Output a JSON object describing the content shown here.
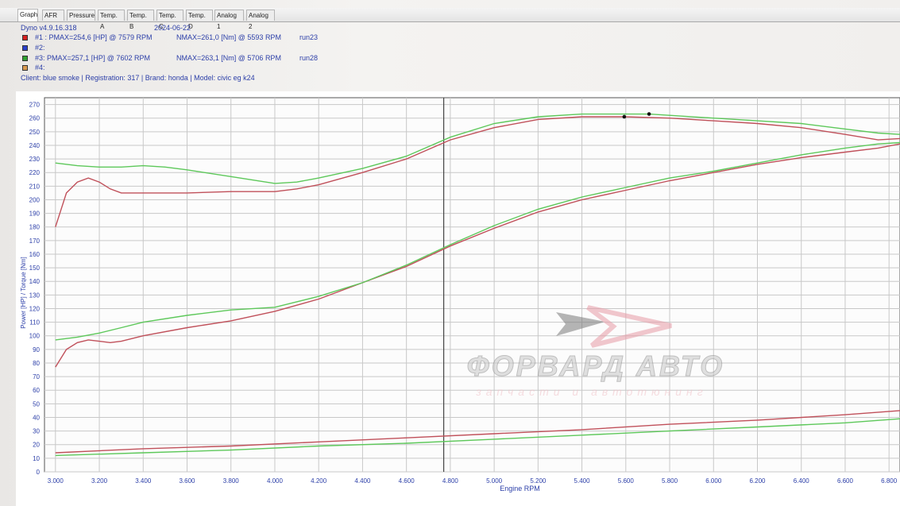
{
  "tabs": [
    "Graph",
    "AFR",
    "Pressure",
    "Temp. A",
    "Temp. B",
    "Temp. C",
    "Temp. D",
    "Analog 1",
    "Analog 2"
  ],
  "header": {
    "version": "Dyno v4.9.16.318",
    "date": "2024-06-22",
    "runs": [
      {
        "label": "#1 : PMAX=254,6 [HP] @ 7579 RPM",
        "nmax": "NMAX=261,0 [Nm] @ 5593 RPM",
        "name": "run23",
        "color": "#d42020"
      },
      {
        "label": "#2:",
        "nmax": "",
        "name": "",
        "color": "#2a3fc9"
      },
      {
        "label": "#3: PMAX=257,1 [HP] @ 7602 RPM",
        "nmax": "NMAX=263,1 [Nm] @ 5706 RPM",
        "name": "run28",
        "color": "#30a030"
      },
      {
        "label": "#4:",
        "nmax": "",
        "name": "",
        "color": "#d89a50"
      }
    ],
    "client": "Client: blue smoke | Registration: 317 | Brand: honda | Model: civic eg k24"
  },
  "watermark": {
    "title": "ФОРВАРД АВТО",
    "subtitle": "запчасти и автотюнинг"
  },
  "colors": {
    "run1": "#c0505a",
    "run3": "#5dc85a",
    "grid": "#c8c8c8",
    "axis_text": "#2c3fa8"
  },
  "chart_data": {
    "type": "line",
    "xlabel": "Engine RPM",
    "ylabel": "Power [HP] / Torque [Nm]",
    "xlim": [
      2950,
      6850
    ],
    "ylim": [
      0,
      275
    ],
    "x_ticks": [
      "3.000",
      "3.200",
      "3.400",
      "3.600",
      "3.800",
      "4.000",
      "4.200",
      "4.400",
      "4.600",
      "4.800",
      "5.000",
      "5.200",
      "5.400",
      "5.600",
      "5.800",
      "6.000",
      "6.200",
      "6.400",
      "6.600",
      "6.800"
    ],
    "x_tick_values": [
      3000,
      3200,
      3400,
      3600,
      3800,
      4000,
      4200,
      4400,
      4600,
      4800,
      5000,
      5200,
      5400,
      5600,
      5800,
      6000,
      6200,
      6400,
      6600,
      6800
    ],
    "y_ticks": [
      0,
      10,
      20,
      30,
      40,
      50,
      60,
      70,
      80,
      90,
      100,
      110,
      120,
      130,
      140,
      150,
      160,
      170,
      180,
      190,
      200,
      210,
      220,
      230,
      240,
      250,
      260,
      270
    ],
    "cursor_rpm": 4770,
    "grid": true,
    "series": [
      {
        "name": "run23",
        "quantity": "torque",
        "color": "#c0505a",
        "x": [
          3000,
          3050,
          3100,
          3150,
          3200,
          3250,
          3300,
          3400,
          3600,
          3800,
          4000,
          4100,
          4200,
          4400,
          4600,
          4800,
          5000,
          5200,
          5400,
          5593,
          5800,
          6000,
          6200,
          6400,
          6600,
          6750,
          6850
        ],
        "y": [
          180,
          205,
          213,
          216,
          213,
          208,
          205,
          205,
          205,
          206,
          206,
          208,
          211,
          220,
          230,
          244,
          253,
          259,
          261,
          261,
          260,
          258,
          256,
          253,
          248,
          244,
          245
        ]
      },
      {
        "name": "run28",
        "quantity": "torque",
        "color": "#5dc85a",
        "x": [
          3000,
          3100,
          3200,
          3300,
          3400,
          3500,
          3600,
          3800,
          4000,
          4100,
          4200,
          4400,
          4600,
          4800,
          5000,
          5200,
          5400,
          5706,
          6000,
          6200,
          6400,
          6600,
          6750,
          6850
        ],
        "y": [
          227,
          225,
          224,
          224,
          225,
          224,
          222,
          217,
          212,
          213,
          216,
          223,
          232,
          246,
          256,
          261,
          263,
          263,
          260,
          258,
          256,
          252,
          249,
          248
        ]
      },
      {
        "name": "run23",
        "quantity": "power",
        "color": "#c0505a",
        "x": [
          3000,
          3050,
          3100,
          3150,
          3200,
          3250,
          3300,
          3400,
          3600,
          3800,
          4000,
          4200,
          4400,
          4600,
          4800,
          5000,
          5200,
          5400,
          5600,
          5800,
          6000,
          6200,
          6400,
          6600,
          6750,
          6850
        ],
        "y": [
          77,
          90,
          95,
          97,
          96,
          95,
          96,
          100,
          106,
          111,
          118,
          127,
          139,
          151,
          166,
          179,
          191,
          200,
          207,
          214,
          220,
          226,
          231,
          235,
          238,
          241
        ]
      },
      {
        "name": "run28",
        "quantity": "power",
        "color": "#5dc85a",
        "x": [
          3000,
          3100,
          3200,
          3300,
          3400,
          3600,
          3800,
          4000,
          4200,
          4400,
          4600,
          4800,
          5000,
          5200,
          5400,
          5600,
          5800,
          6000,
          6200,
          6400,
          6600,
          6750,
          6850
        ],
        "y": [
          97,
          99,
          102,
          106,
          110,
          115,
          119,
          121,
          129,
          139,
          152,
          167,
          181,
          193,
          202,
          209,
          216,
          221,
          227,
          233,
          238,
          241,
          242
        ]
      },
      {
        "name": "run23",
        "quantity": "loss",
        "color": "#c0505a",
        "x": [
          3000,
          3400,
          3800,
          4200,
          4600,
          5000,
          5400,
          5800,
          6200,
          6600,
          6850
        ],
        "y": [
          14,
          17,
          19,
          22,
          25,
          28,
          31,
          35,
          38,
          42,
          45
        ]
      },
      {
        "name": "run28",
        "quantity": "loss",
        "color": "#5dc85a",
        "x": [
          3000,
          3400,
          3800,
          4200,
          4600,
          5000,
          5400,
          5800,
          6200,
          6600,
          6850
        ],
        "y": [
          12,
          14,
          16,
          19,
          21,
          24,
          27,
          30,
          33,
          36,
          39
        ]
      }
    ],
    "markers": [
      {
        "x": 5593,
        "y": 261
      },
      {
        "x": 5706,
        "y": 263
      }
    ]
  }
}
